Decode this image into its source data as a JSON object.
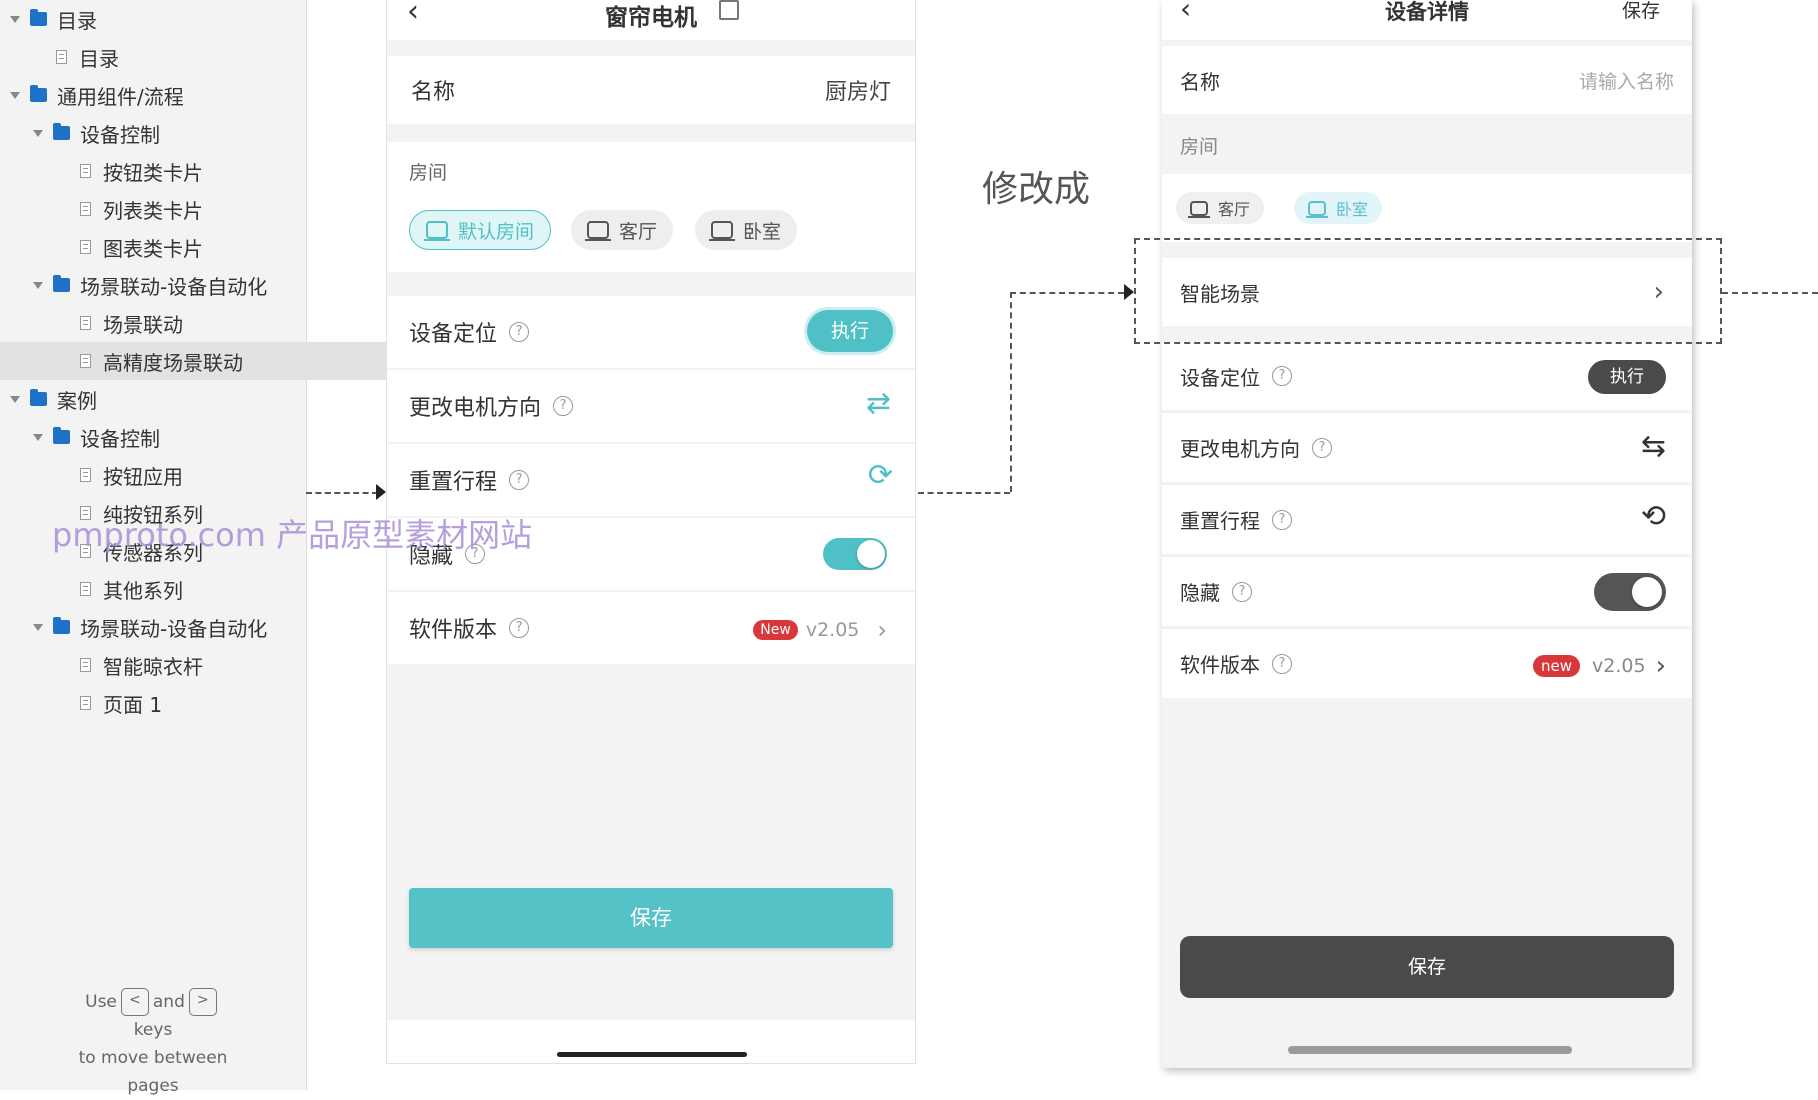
{
  "sidebar": {
    "items": [
      {
        "label": "目录",
        "kind": "folder"
      },
      {
        "label": "目录",
        "kind": "page"
      },
      {
        "label": "通用组件/流程",
        "kind": "folder"
      },
      {
        "label": "设备控制",
        "kind": "folder"
      },
      {
        "label": "按钮类卡片",
        "kind": "page"
      },
      {
        "label": "列表类卡片",
        "kind": "page"
      },
      {
        "label": "图表类卡片",
        "kind": "page"
      },
      {
        "label": "场景联动-设备自动化",
        "kind": "folder"
      },
      {
        "label": "场景联动",
        "kind": "page"
      },
      {
        "label": "高精度场景联动",
        "kind": "page",
        "selected": true
      },
      {
        "label": "案例",
        "kind": "folder"
      },
      {
        "label": "设备控制",
        "kind": "folder"
      },
      {
        "label": "按钮应用",
        "kind": "page"
      },
      {
        "label": "纯按钮系列",
        "kind": "page"
      },
      {
        "label": "传感器系列",
        "kind": "page"
      },
      {
        "label": "其他系列",
        "kind": "page"
      },
      {
        "label": "场景联动-设备自动化",
        "kind": "folder"
      },
      {
        "label": "智能晾衣杆",
        "kind": "page"
      },
      {
        "label": "页面 1",
        "kind": "page"
      }
    ],
    "hint": {
      "use": "Use",
      "and": "and",
      "keys": "keys",
      "move": "to move between",
      "pages": "pages",
      "key_left": "<",
      "key_right": ">"
    }
  },
  "watermark": "pmproto.com 产品原型素材网站",
  "phone1": {
    "back_icon": "chevron-left-icon",
    "title": "窗帘电机",
    "edit_icon": "edit-icon",
    "name_label": "名称",
    "name_value": "厨房灯",
    "room_label": "房间",
    "rooms": [
      "默认房间",
      "客厅",
      "卧室"
    ],
    "selected_room": "默认房间",
    "locate_label": "设备定位",
    "execute_label": "执行",
    "direction_label": "更改电机方向",
    "direction_icon": "swap-arrows-icon",
    "reset_label": "重置行程",
    "reset_icon": "refresh-icon",
    "hide_label": "隐藏",
    "hide_on": true,
    "version_label": "软件版本",
    "version_badge": "New",
    "version_value": "v2.05",
    "save_label": "保存",
    "accent": "#4fc1c6"
  },
  "note": "修改成",
  "phone2": {
    "back_icon": "chevron-left-icon",
    "title": "设备详情",
    "save_top": "保存",
    "name_label": "名称",
    "name_placeholder": "请输入名称",
    "room_label": "房间",
    "rooms": [
      "客厅",
      "卧室"
    ],
    "selected_room": "卧室",
    "scene_label": "智能场景",
    "locate_label": "设备定位",
    "execute_label": "执行",
    "direction_label": "更改电机方向",
    "reset_label": "重置行程",
    "hide_label": "隐藏",
    "hide_on": true,
    "version_label": "软件版本",
    "version_badge": "new",
    "version_value": "v2.05",
    "save_label": "保存",
    "dark": "#4a4a4a",
    "badge_color": "#d9383a"
  }
}
